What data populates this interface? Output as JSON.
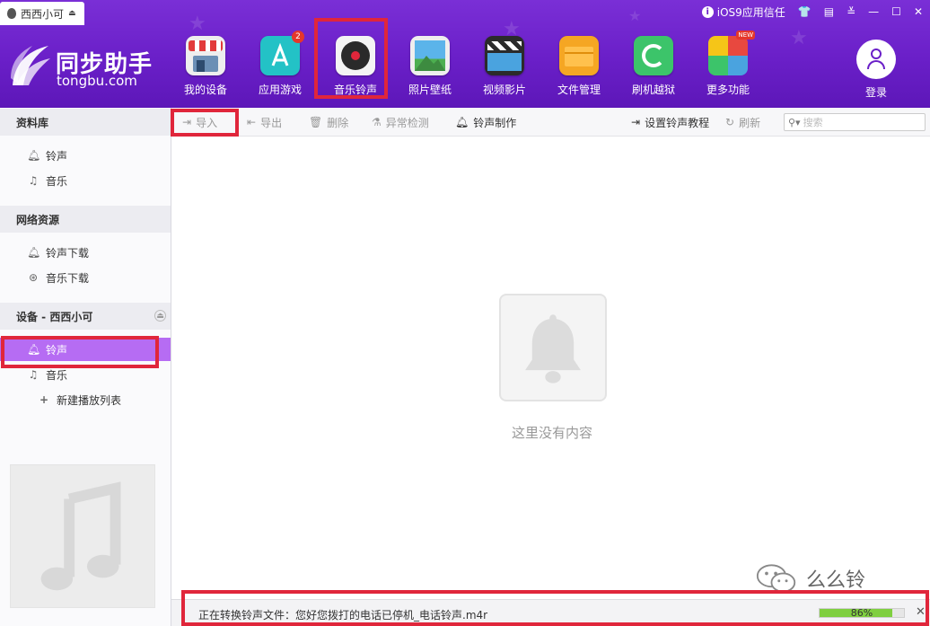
{
  "titlebar": {
    "device_tab": "西西小可",
    "ios9_label": "iOS9应用信任",
    "window_controls": [
      "shirt-icon",
      "chat-icon",
      "menu-icon",
      "minimize-icon",
      "maximize-icon",
      "close-icon"
    ]
  },
  "logo": {
    "name": "同步助手",
    "url": "tongbu.com"
  },
  "nav": {
    "items": [
      {
        "label": "我的设备",
        "icon": "store-icon",
        "color": "#e8e8e8"
      },
      {
        "label": "应用游戏",
        "icon": "appstore-icon",
        "color": "#23c2c6",
        "badge": "2"
      },
      {
        "label": "音乐铃声",
        "icon": "vinyl-icon",
        "color": "#f2f2f2"
      },
      {
        "label": "照片壁纸",
        "icon": "photo-icon",
        "color": "#4aa3df"
      },
      {
        "label": "视频影片",
        "icon": "clapper-icon",
        "color": "#2b2b2b"
      },
      {
        "label": "文件管理",
        "icon": "folder-icon",
        "color": "#f5a623"
      },
      {
        "label": "刷机越狱",
        "icon": "refresh-icon",
        "color": "#3cc46a"
      },
      {
        "label": "更多功能",
        "icon": "grid-icon",
        "color": "#f5c518",
        "badge_new": "NEW"
      }
    ],
    "login": "登录"
  },
  "sidebar": {
    "section_library": "资料库",
    "library_items": [
      "铃声",
      "音乐"
    ],
    "section_network": "网络资源",
    "network_items": [
      "铃声下载",
      "音乐下载"
    ],
    "section_device": "设备 - 西西小可",
    "device_items": [
      "铃声",
      "音乐",
      "新建播放列表"
    ]
  },
  "toolbar": {
    "import": "导入",
    "export": "导出",
    "delete": "删除",
    "detect": "异常检测",
    "make": "铃声制作",
    "tutorial": "设置铃声教程",
    "refresh": "刷新",
    "search_placeholder": "搜索"
  },
  "main": {
    "empty_text": "这里没有内容"
  },
  "watermark": "么么铃",
  "statusbar": {
    "text": "正在转换铃声文件：您好您拨打的电话已停机_电话铃声.m4r",
    "progress": 0.86,
    "progress_label": "86%"
  },
  "colors": {
    "header": "#6a1fc8",
    "active": "#b66cf3",
    "highlight": "#e0263b",
    "progress": "#7fcf3f"
  }
}
